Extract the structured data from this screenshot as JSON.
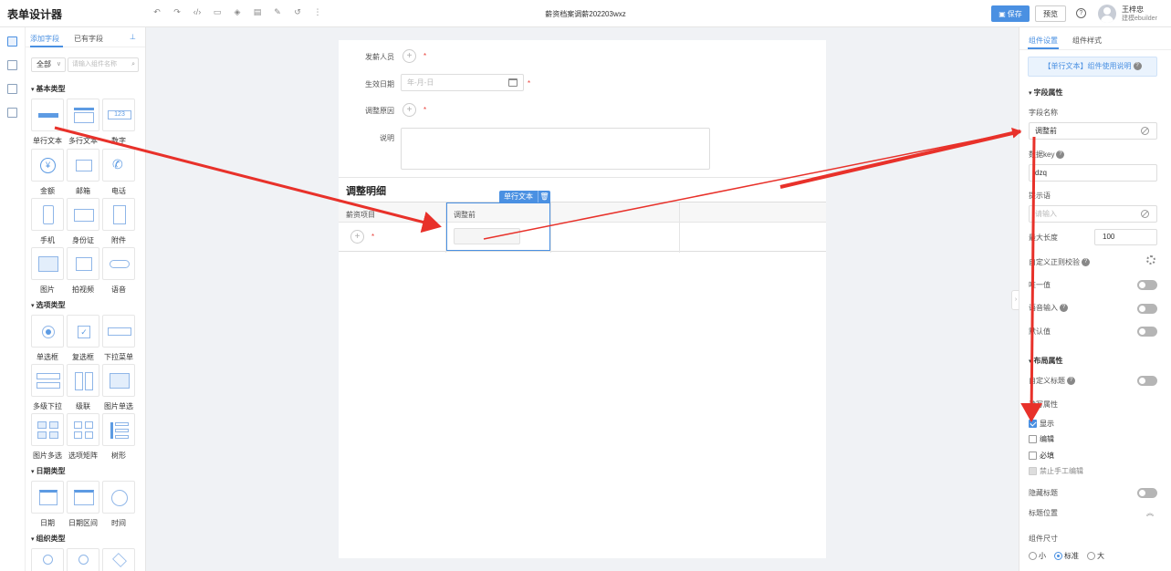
{
  "app": {
    "title": "表单设计器",
    "document_title": "薪资档案调薪202203wxz"
  },
  "toolbar": {
    "icons": [
      "undo-icon",
      "redo-icon",
      "code-icon",
      "preview-window-icon",
      "layers-icon",
      "save-template-icon",
      "edit-icon",
      "history-icon",
      "more-icon"
    ],
    "save_label": "保存",
    "preview_label": "预览"
  },
  "user": {
    "name": "王梓忠",
    "org": "建模ebuilder"
  },
  "left_panel": {
    "tabs": [
      "添加字段",
      "已有字段"
    ],
    "filter_label": "全部",
    "search_placeholder": "请输入组件名称",
    "categories": [
      {
        "title": "基本类型",
        "items": [
          "单行文本",
          "多行文本",
          "数字",
          "金额",
          "邮箱",
          "电话",
          "手机",
          "身份证",
          "附件",
          "图片",
          "拍视频",
          "语音"
        ]
      },
      {
        "title": "选项类型",
        "items": [
          "单选框",
          "复选框",
          "下拉菜单",
          "多级下拉",
          "级联",
          "图片单选",
          "图片多选",
          "选项矩阵",
          "树形"
        ]
      },
      {
        "title": "日期类型",
        "items": [
          "日期",
          "日期区间",
          "时间"
        ]
      },
      {
        "title": "组织类型",
        "items": [
          "",
          "",
          ""
        ]
      }
    ]
  },
  "form": {
    "fields": [
      {
        "label": "发薪人员"
      },
      {
        "label": "生效日期",
        "placeholder": "年-月-日"
      },
      {
        "label": "调整原因"
      },
      {
        "label": "说明"
      }
    ],
    "detail": {
      "title": "调整明细",
      "columns": [
        "薪资项目",
        "调整前",
        ""
      ],
      "selected_tag": "单行文本"
    }
  },
  "right_panel": {
    "tabs": [
      "组件设置",
      "组件样式"
    ],
    "usage_link": "【单行文本】组件使用说明",
    "field_props_title": "字段属性",
    "field_name_label": "字段名称",
    "field_name_value": "调整前",
    "data_key_label": "数据key",
    "data_key_value": "dzq",
    "hint_label": "提示语",
    "hint_placeholder": "请输入",
    "max_length_label": "最大长度",
    "max_length_value": "100",
    "regex_label": "自定义正则校验",
    "unique_label": "唯一值",
    "voice_label": "语音输入",
    "default_label": "默认值",
    "layout_props_title": "布局属性",
    "custom_title_label": "自定义标题",
    "rw_label": "读写属性",
    "show_label": "显示",
    "edit_label": "编辑",
    "required_label": "必填",
    "no_manual_label": "禁止手工编辑",
    "hide_title_label": "隐藏标题",
    "title_pos_label": "标题位置",
    "size_label": "组件尺寸",
    "size_options": [
      "小",
      "标准",
      "大"
    ],
    "size_selected": "标准"
  },
  "colors": {
    "accent": "#4a90e2",
    "arrow": "#e8312a",
    "required": "#e9413b"
  }
}
